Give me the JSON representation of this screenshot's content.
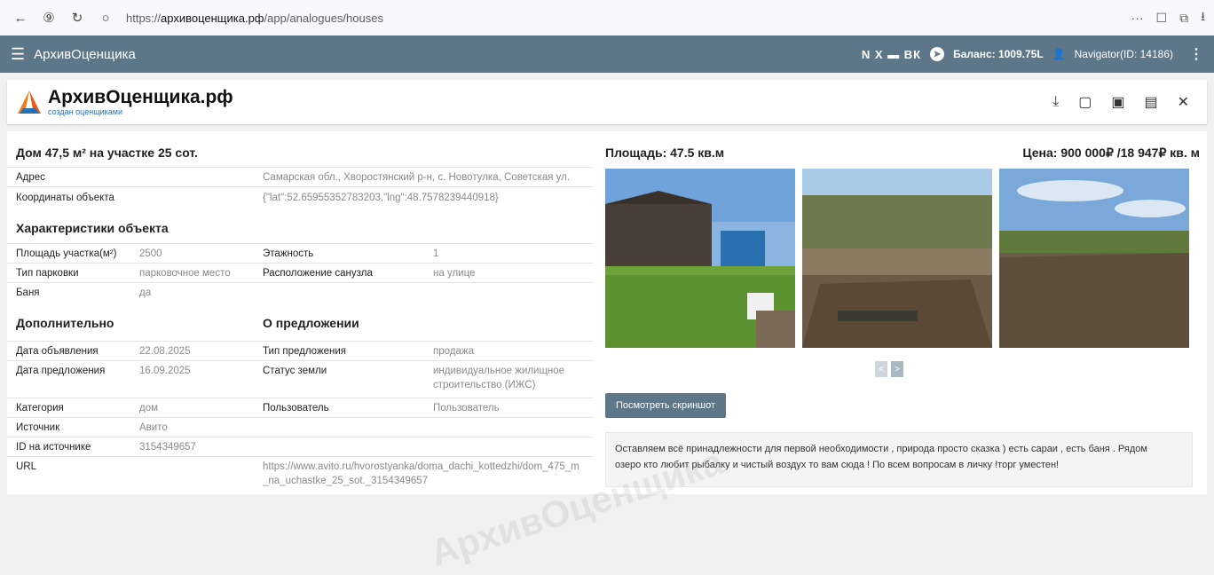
{
  "browser": {
    "url_prefix": "https://",
    "url_domain": "архивоценщика.рф",
    "url_path": "/app/analogues/houses"
  },
  "appbar": {
    "title": "АрхивОценщика",
    "social_text": "N X ▬ ВК",
    "balance": "Баланс: 1009.75L",
    "user": "Navigator(ID: 14186)"
  },
  "logo": {
    "name": "АрхивОценщика.рф",
    "tagline": "создан оценщиками"
  },
  "listing": {
    "title": "Дом 47,5 м² на участке 25 сот.",
    "address_label": "Адрес",
    "address": "Самарская обл., Хворостянский р-н, с. Новотулка, Советская ул.",
    "coords_label": "Координаты объекта",
    "coords": "{\"lat\":52.65955352783203,\"lng\":48.7578239440918}"
  },
  "characteristics": {
    "heading": "Характеристики объекта",
    "plot_area_label": "Площадь участка(м²)",
    "plot_area": "2500",
    "floors_label": "Этажность",
    "floors": "1",
    "parking_label": "Тип парковки",
    "parking": "парковочное место",
    "bathroom_label": "Расположение санузла",
    "bathroom": "на улице",
    "sauna_label": "Баня",
    "sauna": "да"
  },
  "additional": {
    "heading": "Дополнительно",
    "ad_date_label": "Дата объявления",
    "ad_date": "22.08.2025",
    "offer_date_label": "Дата предложения",
    "offer_date": "16.09.2025",
    "category_label": "Категория",
    "category": "дом",
    "source_label": "Источник",
    "source": "Авито",
    "source_id_label": "ID на источнике",
    "source_id": "3154349657",
    "url_label": "URL",
    "url_line1": "https://www.avito.ru/hvorostyanka/doma_dachi_kottedzhi/dom_475_m",
    "url_line2": "_na_uchastke_25_sot._3154349657"
  },
  "offer": {
    "heading": "О предложении",
    "type_label": "Тип предложения",
    "type": "продажа",
    "land_label": "Статус земли",
    "land_line1": "индивидуальное жилищное",
    "land_line2": "строительство (ИЖС)",
    "user_label": "Пользователь",
    "user": "Пользователь"
  },
  "right": {
    "area": "Площадь: 47.5 кв.м",
    "price": "Цена: 900 000₽ /18 947₽ кв. м",
    "prev": "<",
    "next": ">",
    "screenshot_button": "Посмотреть скриншот",
    "description_line1": "Оставляем всё принадлежности для первой необходимости , природа просто сказка ) есть сараи , есть баня . Рядом",
    "description_line2": "озеро кто любит рыбалку и чистый воздух то вам сюда ! По всем вопросам в личку !торг уместен!"
  },
  "watermark": "АрхивОценщика"
}
